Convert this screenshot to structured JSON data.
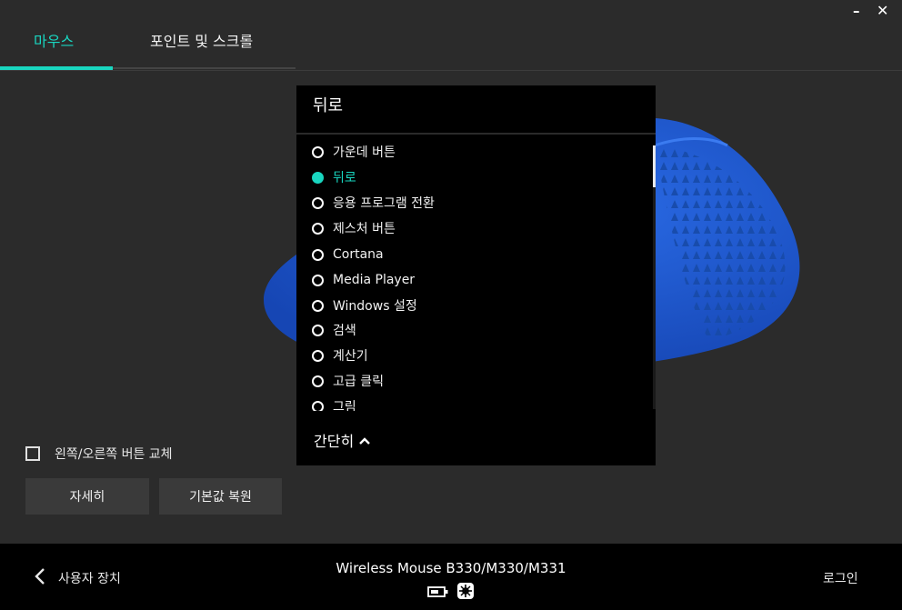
{
  "window": {
    "minimize_icon": "minimize-icon",
    "close_icon": "close-icon",
    "minimize_glyph": "–",
    "close_glyph": "✕"
  },
  "tabs": [
    {
      "label": "마우스",
      "active": true
    },
    {
      "label": "포인트 및 스크롤",
      "active": false
    }
  ],
  "colors": {
    "accent": "#19d6c0",
    "background": "#2b2b2b",
    "panel": "#000000",
    "mouse_blue": "#1e5bd1"
  },
  "dropdown": {
    "header": "뒤로",
    "selected": "뒤로",
    "items": [
      {
        "label": "가운데 버튼",
        "selected": false
      },
      {
        "label": "뒤로",
        "selected": true
      },
      {
        "label": "응용 프로그램 전환",
        "selected": false
      },
      {
        "label": "제스처 버튼",
        "selected": false
      },
      {
        "label": "Cortana",
        "selected": false
      },
      {
        "label": "Media Player",
        "selected": false
      },
      {
        "label": "Windows 설정",
        "selected": false
      },
      {
        "label": "검색",
        "selected": false
      },
      {
        "label": "계산기",
        "selected": false
      },
      {
        "label": "고급 클릭",
        "selected": false
      },
      {
        "label": "그림",
        "selected": false
      }
    ],
    "collapse_label": "간단히",
    "collapse_icon": "chevron-up-icon"
  },
  "controls": {
    "swap_label": "왼쪽/오른쪽 버튼 교체",
    "swap_checked": false,
    "detail_button": "자세히",
    "reset_button": "기본값 복원"
  },
  "footer": {
    "back_label": "사용자 장치",
    "device_name": "Wireless Mouse B330/M330/M331",
    "battery_icon": "battery-icon",
    "receiver_icon": "unifying-receiver-icon",
    "login_label": "로그인"
  }
}
